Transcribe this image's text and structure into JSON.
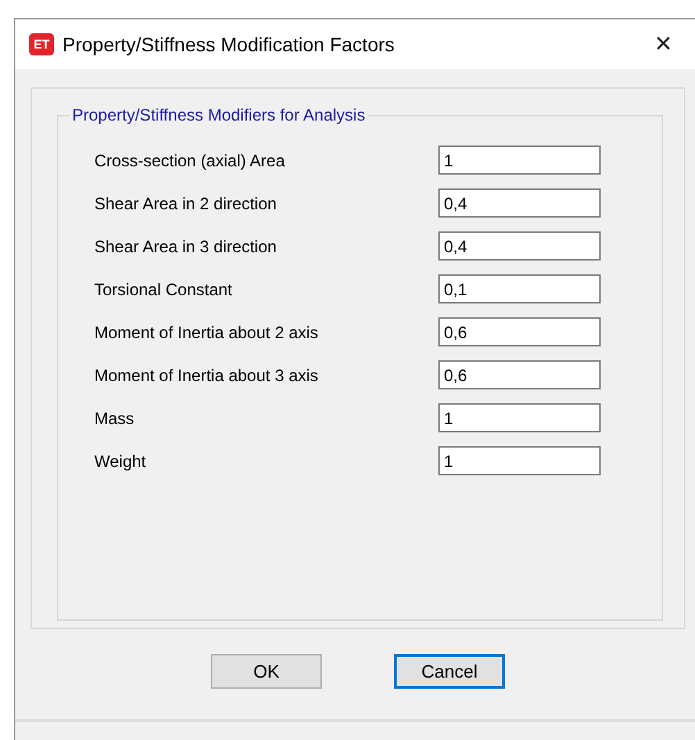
{
  "window": {
    "icon_text": "ET",
    "title": "Property/Stiffness Modification Factors",
    "close": "✕"
  },
  "group": {
    "title": "Property/Stiffness Modifiers for Analysis",
    "fields": [
      {
        "label": "Cross-section (axial) Area",
        "value": "1"
      },
      {
        "label": "Shear Area in 2 direction",
        "value": "0,4"
      },
      {
        "label": "Shear Area in 3 direction",
        "value": "0,4"
      },
      {
        "label": "Torsional Constant",
        "value": "0,1"
      },
      {
        "label": "Moment of Inertia about 2 axis",
        "value": "0,6"
      },
      {
        "label": "Moment of Inertia about 3 axis",
        "value": "0,6"
      },
      {
        "label": "Mass",
        "value": "1"
      },
      {
        "label": "Weight",
        "value": "1"
      }
    ]
  },
  "buttons": [
    {
      "label": "OK",
      "focused": false
    },
    {
      "label": "Cancel",
      "focused": true
    }
  ]
}
